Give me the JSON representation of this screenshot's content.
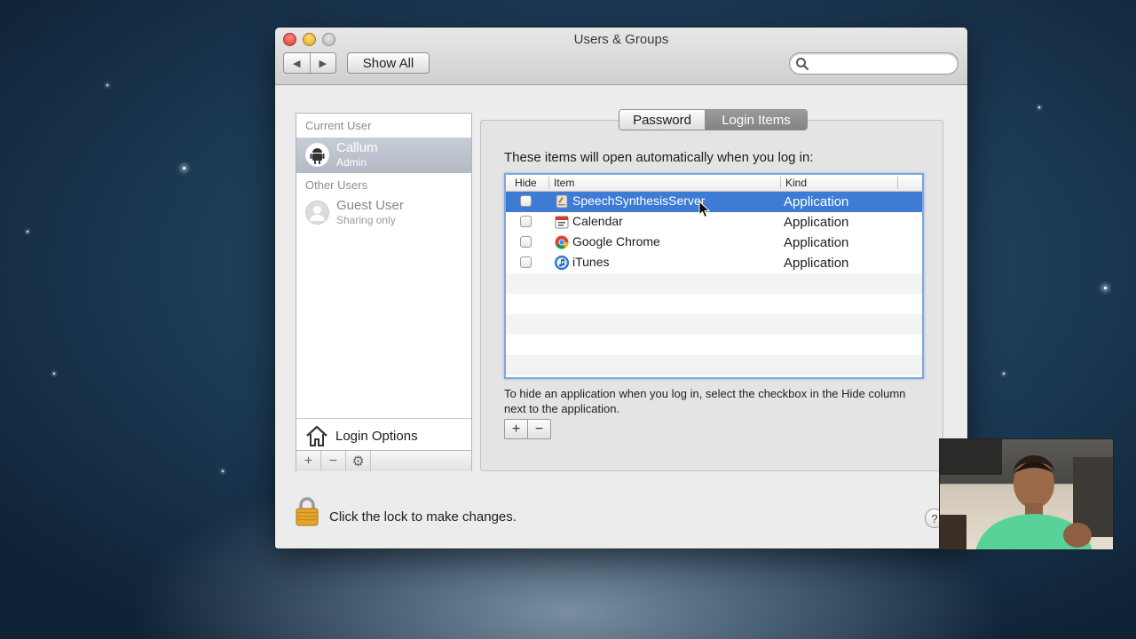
{
  "window": {
    "title": "Users & Groups",
    "show_all_label": "Show All",
    "search_placeholder": ""
  },
  "sidebar": {
    "current_user_header": "Current User",
    "other_users_header": "Other Users",
    "current_user": {
      "name": "Callum",
      "role": "Admin"
    },
    "other_users": [
      {
        "name": "Guest User",
        "role": "Sharing only"
      }
    ],
    "login_options_label": "Login Options",
    "toolbar": {
      "add": "+",
      "remove": "−",
      "settings": "⚙"
    }
  },
  "tabs": [
    {
      "label": "Password",
      "active": false
    },
    {
      "label": "Login Items",
      "active": true
    }
  ],
  "login_items": {
    "intro": "These items will open automatically when you log in:",
    "columns": {
      "hide": "Hide",
      "item": "Item",
      "kind": "Kind"
    },
    "rows": [
      {
        "name": "SpeechSynthesisServer",
        "kind": "Application",
        "icon": "speech-icon",
        "selected": true
      },
      {
        "name": "Calendar",
        "kind": "Application",
        "icon": "calendar-icon",
        "selected": false
      },
      {
        "name": "Google Chrome",
        "kind": "Application",
        "icon": "chrome-icon",
        "selected": false
      },
      {
        "name": "iTunes",
        "kind": "Application",
        "icon": "itunes-icon",
        "selected": false
      }
    ],
    "hint": "To hide an application when you log in, select the checkbox in the Hide column next to the application.",
    "add_label": "+",
    "remove_label": "−"
  },
  "footer": {
    "lock_text": "Click the lock to make changes.",
    "help_label": "?"
  },
  "colors": {
    "selection_blue": "#3d7bd5",
    "sidebar_selected": "#b3b9c5",
    "lock_gold": "#e6a52a"
  }
}
